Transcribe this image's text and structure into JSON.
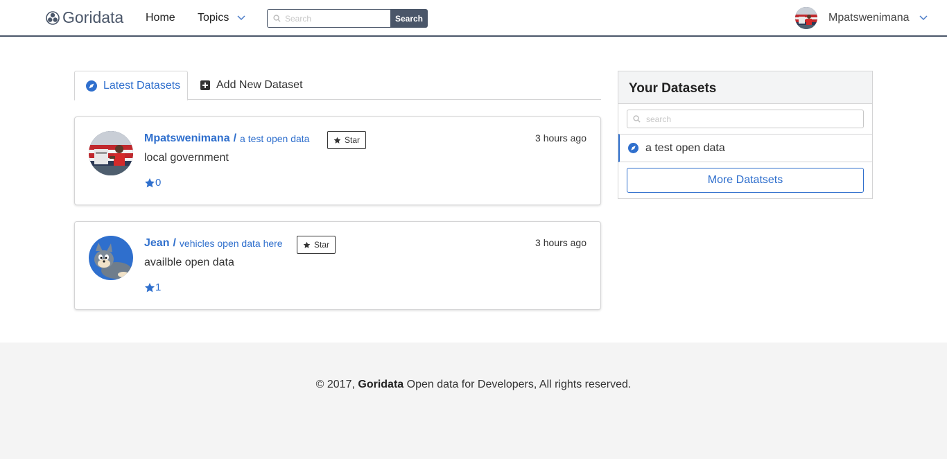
{
  "nav": {
    "brand": "Goridata",
    "home": "Home",
    "topics": "Topics",
    "search_placeholder": "Search",
    "search_button": "Search",
    "user": "Mpatswenimana"
  },
  "tabs": {
    "latest": "Latest Datasets",
    "add": "Add New Dataset"
  },
  "feed": [
    {
      "owner": "Mpatswenimana",
      "slash": "/",
      "dataset": "a test open data",
      "star_label": "Star",
      "time": "3 hours ago",
      "description": "local government",
      "stars": "0"
    },
    {
      "owner": "Jean",
      "slash": "/",
      "dataset": "vehicles open data here",
      "star_label": "Star",
      "time": "3 hours ago",
      "description": "availble open data",
      "stars": "1"
    }
  ],
  "sidebar": {
    "title": "Your Datasets",
    "search_placeholder": "search",
    "item": "a test open data",
    "more": "More Datatsets"
  },
  "footer": {
    "prefix": "© 2017,",
    "brand": "Goridata",
    "suffix": "Open data for Developers, All rights reserved."
  },
  "colors": {
    "accent": "#2f6fcd",
    "navbar_border": "#4a5669"
  }
}
